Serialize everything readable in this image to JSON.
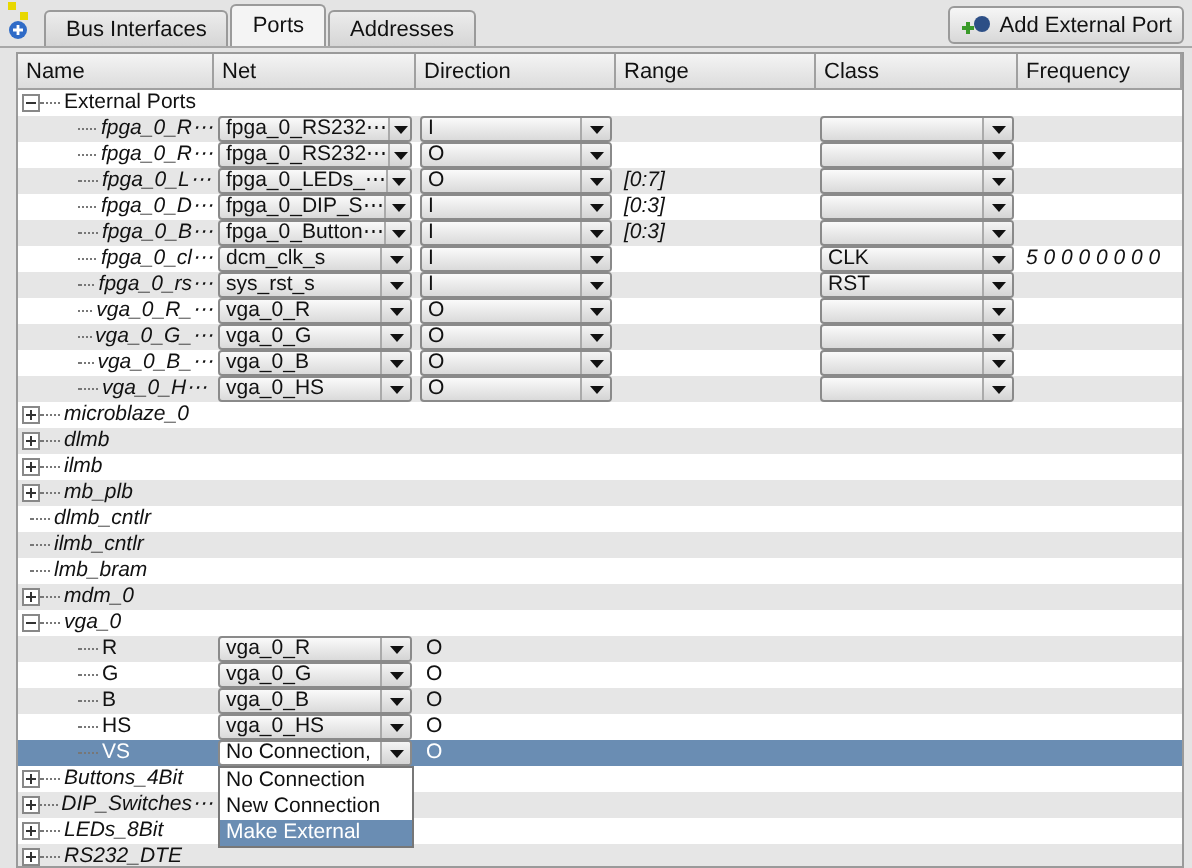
{
  "tabs": [
    {
      "label": "Bus Interfaces",
      "selected": false
    },
    {
      "label": "Ports",
      "selected": true
    },
    {
      "label": "Addresses",
      "selected": false
    }
  ],
  "add_button": {
    "label": "Add External Port"
  },
  "table": {
    "columns": [
      "Name",
      "Net",
      "Direction",
      "Range",
      "Class",
      "Frequency"
    ],
    "rows": [
      {
        "name": "External Ports",
        "kind": "group",
        "expanded": true,
        "selected": false,
        "children": [
          {
            "name": "fpga_0_R⋯",
            "kind": "external",
            "selected": false,
            "net": "fpga_0_RS232⋯",
            "direction": "I"
          },
          {
            "name": "fpga_0_R⋯",
            "kind": "external",
            "selected": false,
            "net": "fpga_0_RS232⋯",
            "direction": "O"
          },
          {
            "name": "fpga_0_L⋯",
            "kind": "external",
            "selected": false,
            "net": "fpga_0_LEDs_⋯",
            "direction": "O",
            "range": "[0:7]"
          },
          {
            "name": "fpga_0_D⋯",
            "kind": "external",
            "selected": false,
            "net": "fpga_0_DIP_S⋯",
            "direction": "I",
            "range": "[0:3]"
          },
          {
            "name": "fpga_0_B⋯",
            "kind": "external",
            "selected": false,
            "net": "fpga_0_Button⋯",
            "direction": "I",
            "range": "[0:3]"
          },
          {
            "name": "fpga_0_cl⋯",
            "kind": "external",
            "selected": false,
            "net": "dcm_clk_s",
            "direction": "I",
            "class": "CLK",
            "frequency": "5 0 0 0 0 0 0 0"
          },
          {
            "name": "fpga_0_rs⋯",
            "kind": "external",
            "selected": false,
            "net": "sys_rst_s",
            "direction": "I",
            "class": "RST"
          },
          {
            "name": "vga_0_R_⋯",
            "kind": "external",
            "selected": false,
            "net": "vga_0_R",
            "direction": "O"
          },
          {
            "name": "vga_0_G_⋯",
            "kind": "external",
            "selected": false,
            "net": "vga_0_G",
            "direction": "O"
          },
          {
            "name": "vga_0_B_⋯",
            "kind": "external",
            "selected": false,
            "net": "vga_0_B",
            "direction": "O"
          },
          {
            "name": "vga_0_H⋯",
            "kind": "external",
            "selected": false,
            "net": "vga_0_HS",
            "direction": "O"
          }
        ]
      },
      {
        "name": "microblaze_0",
        "kind": "instance",
        "expanded": false,
        "selected": false
      },
      {
        "name": "dlmb",
        "kind": "instance",
        "expanded": false,
        "selected": false
      },
      {
        "name": "ilmb",
        "kind": "instance",
        "expanded": false,
        "selected": false
      },
      {
        "name": "mb_plb",
        "kind": "instance",
        "expanded": false,
        "selected": false
      },
      {
        "name": "dlmb_cntlr",
        "kind": "instance",
        "selected": false
      },
      {
        "name": "ilmb_cntlr",
        "kind": "instance",
        "selected": false
      },
      {
        "name": "lmb_bram",
        "kind": "instance",
        "selected": false
      },
      {
        "name": "mdm_0",
        "kind": "instance",
        "expanded": false,
        "selected": false
      },
      {
        "name": "vga_0",
        "kind": "instance",
        "expanded": true,
        "selected": false,
        "children": [
          {
            "name": "R",
            "kind": "port",
            "selected": false,
            "net": "vga_0_R",
            "direction": "O"
          },
          {
            "name": "G",
            "kind": "port",
            "selected": false,
            "net": "vga_0_G",
            "direction": "O"
          },
          {
            "name": "B",
            "kind": "port",
            "selected": false,
            "net": "vga_0_B",
            "direction": "O"
          },
          {
            "name": "HS",
            "kind": "port",
            "selected": false,
            "net": "vga_0_HS",
            "direction": "O"
          },
          {
            "name": "VS",
            "kind": "port",
            "selected": true,
            "net": "No Connection,",
            "direction": "O",
            "open": true,
            "options": [
              {
                "label": "No Connection",
                "selected": false
              },
              {
                "label": "New Connection",
                "selected": false
              },
              {
                "label": "Make External",
                "selected": true
              }
            ]
          }
        ]
      },
      {
        "name": "Buttons_4Bit",
        "kind": "instance",
        "expanded": false,
        "selected": false
      },
      {
        "name": "DIP_Switches⋯",
        "kind": "instance",
        "expanded": false,
        "selected": false
      },
      {
        "name": "LEDs_8Bit",
        "kind": "instance",
        "expanded": false,
        "selected": false
      },
      {
        "name": "RS232_DTE",
        "kind": "instance",
        "expanded": false,
        "selected": false
      }
    ]
  }
}
